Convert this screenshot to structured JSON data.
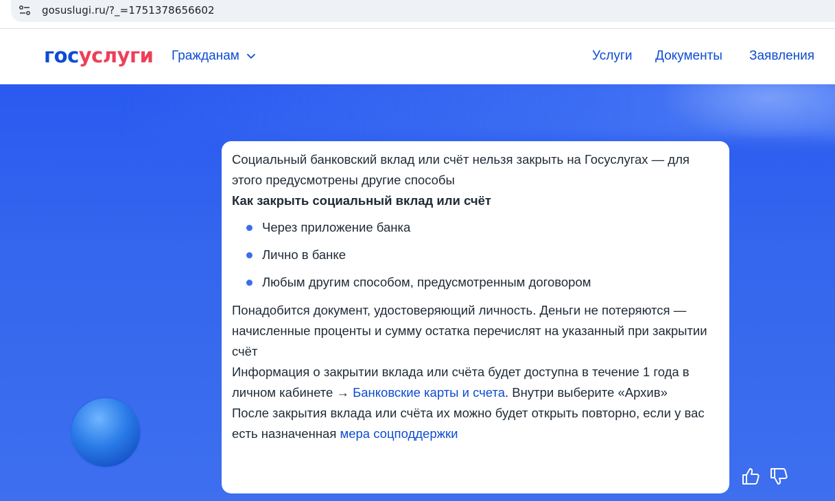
{
  "browser": {
    "url": "gosuslugi.ru/?_=1751378656602",
    "site_info_icon": "tune-icon"
  },
  "header": {
    "logo_part1": "гос",
    "logo_part2": "услуги",
    "audience_label": "Гражданам",
    "nav": {
      "services": "Услуги",
      "documents": "Документы",
      "applications": "Заявления"
    }
  },
  "card": {
    "intro": "Социальный банковский вклад или счёт нельзя закрыть на Госуслугах — для этого предусмотрены другие способы",
    "section_title": "Как закрыть социальный вклад или счёт",
    "bullets": [
      "Через приложение банка",
      "Лично в банке",
      "Любым другим способом, предусмотренным договором"
    ],
    "docs_paragraph": "Понадобится документ, удостоверяющий личность. Деньги не потеряются — начисленные проценты и сумму остатка перечислят на указанный при закрытии счёт",
    "info_prefix": "Информация о закрытии вклада или счёта будет доступна в течение 1 года в личном кабинете → ",
    "info_link": "Банковские карты и счета",
    "info_suffix": ". Внутри выберите «Архив»",
    "reopen_prefix": "После закрытия вклада или счёта их можно будет открыть повторно, если у вас есть назначенная ",
    "reopen_link": "мера соцподдержки"
  },
  "feedback": {
    "like_icon": "thumbs-up-icon",
    "dislike_icon": "thumbs-down-icon"
  },
  "colors": {
    "brand_blue": "#0d4cd3",
    "brand_red": "#ee3f58",
    "hero_blue": "#3466ee",
    "bullet_blue": "#3b6cf0"
  }
}
